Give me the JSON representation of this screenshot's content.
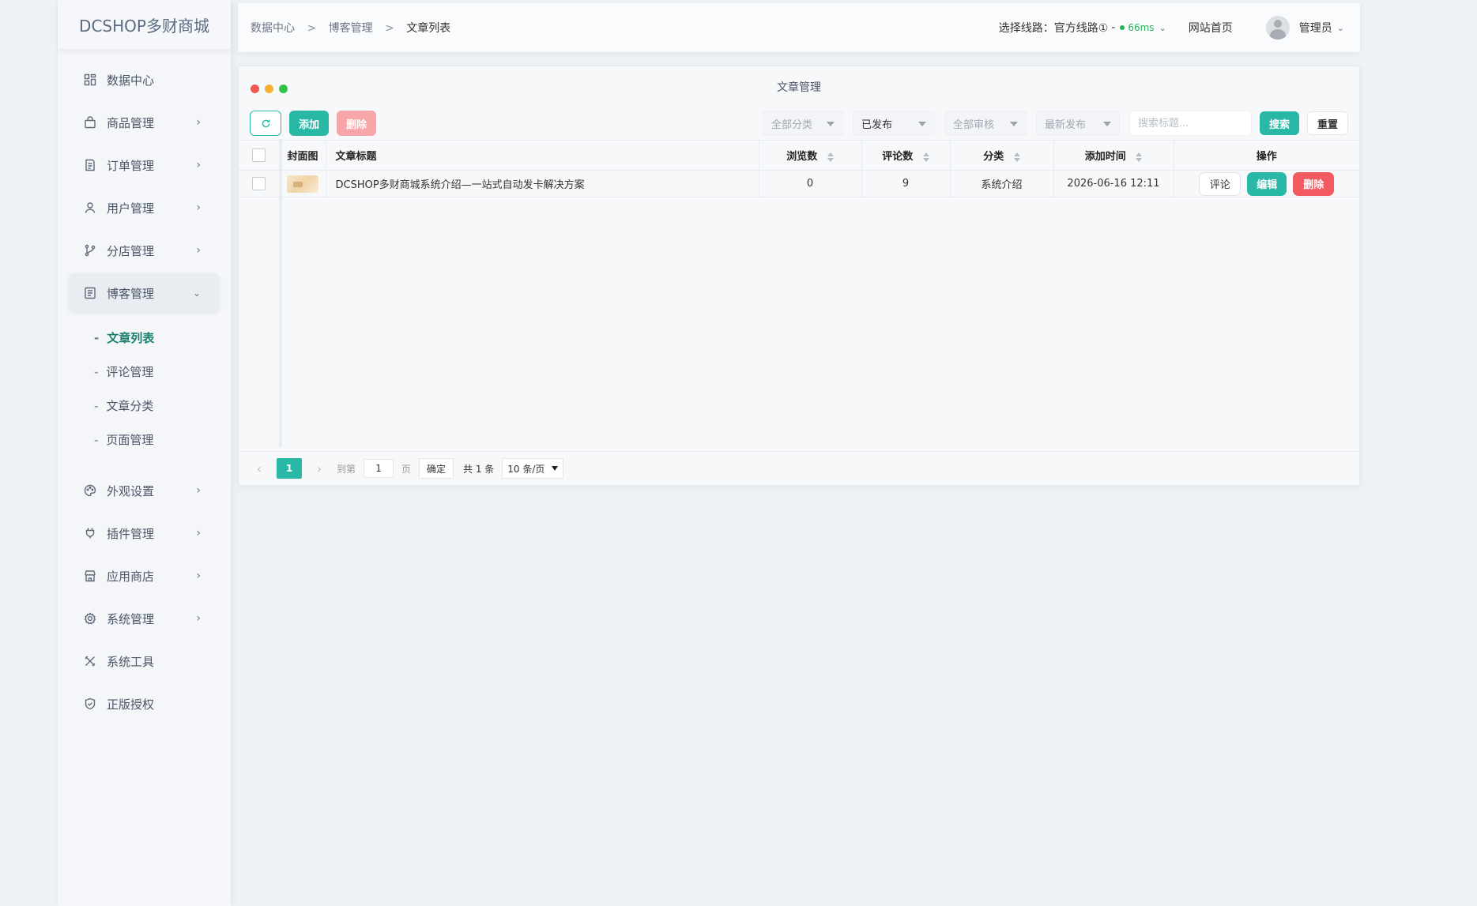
{
  "brand": {
    "logo_text": "DCSHOP多财商城"
  },
  "sidebar": {
    "items": [
      {
        "label": "数据中心",
        "icon": "dashboard-icon",
        "has_children": false
      },
      {
        "label": "商品管理",
        "icon": "bag-icon",
        "has_children": true
      },
      {
        "label": "订单管理",
        "icon": "order-icon",
        "has_children": true
      },
      {
        "label": "用户管理",
        "icon": "user-icon",
        "has_children": true
      },
      {
        "label": "分店管理",
        "icon": "branch-icon",
        "has_children": true
      },
      {
        "label": "博客管理",
        "icon": "blog-icon",
        "has_children": true,
        "expanded": true
      },
      {
        "label": "外观设置",
        "icon": "palette-icon",
        "has_children": true
      },
      {
        "label": "插件管理",
        "icon": "plug-icon",
        "has_children": true
      },
      {
        "label": "应用商店",
        "icon": "store-icon",
        "has_children": true
      },
      {
        "label": "系统管理",
        "icon": "gear-icon",
        "has_children": true
      },
      {
        "label": "系统工具",
        "icon": "tools-icon",
        "has_children": false
      },
      {
        "label": "正版授权",
        "icon": "shield-icon",
        "has_children": false
      }
    ],
    "blog_sub": [
      {
        "label": "文章列表",
        "current": true
      },
      {
        "label": "评论管理"
      },
      {
        "label": "文章分类"
      },
      {
        "label": "页面管理"
      }
    ]
  },
  "header": {
    "breadcrumb": [
      "数据中心",
      "博客管理",
      "文章列表"
    ],
    "breadcrumb_sep": ">",
    "route_label": "选择线路：官方线路①",
    "route_dash": "-",
    "route_latency": "66ms",
    "home_link": "网站首页",
    "user_name": "管理员"
  },
  "card": {
    "title": "文章管理",
    "window_dots": [
      "#f05a50",
      "#f5b230",
      "#2fc444"
    ],
    "toolbar": {
      "add_label": "添加",
      "delete_label": "删除"
    },
    "filters": {
      "category": "全部分类",
      "status": "已发布",
      "review": "全部审核",
      "sort": "最新发布",
      "search_placeholder": "搜索标题...",
      "search_label": "搜索",
      "reset_label": "重置"
    },
    "table": {
      "columns": [
        "封面图",
        "文章标题",
        "浏览数",
        "评论数",
        "分类",
        "添加时间",
        "操作"
      ],
      "rows": [
        {
          "title": "DCSHOP多财商城系统介绍—一站式自动发卡解决方案",
          "views": "0",
          "comments": "9",
          "category": "系统介绍",
          "added": "2026-06-16 12:11",
          "actions": {
            "comment": "评论",
            "edit": "编辑",
            "delete": "删除"
          }
        }
      ]
    },
    "pager": {
      "current": "1",
      "goto_label": "到第",
      "goto_value": "1",
      "page_unit": "页",
      "confirm": "确定",
      "total": "共 1 条",
      "page_size": "10 条/页"
    }
  },
  "colors": {
    "accent": "#2ab8a6",
    "danger": "#f05a60",
    "latency_ok": "#27b05a"
  }
}
